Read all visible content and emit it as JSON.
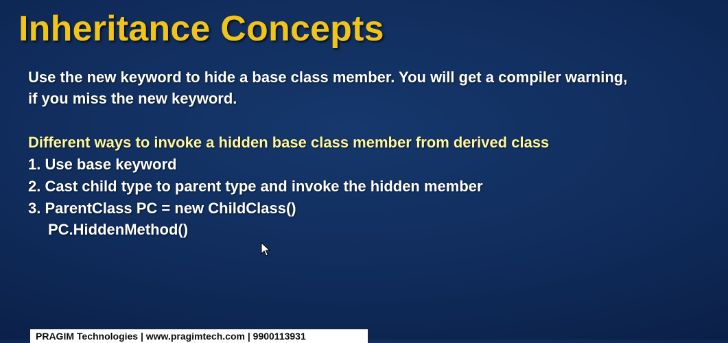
{
  "slide": {
    "title": "Inheritance Concepts",
    "paragraph": [
      "Use the new keyword to hide a base class member. You will get a compiler warning,",
      "if you miss the new keyword."
    ],
    "subheading": "Different ways to invoke a hidden base class member from derived class",
    "items": [
      "1. Use base keyword",
      "2. Cast child type to parent type and invoke the hidden member",
      "3. ParentClass PC = new ChildClass()",
      "PC.HiddenMethod()"
    ],
    "footer": "PRAGIM Technologies | www.pragimtech.com | 9900113931"
  },
  "colors": {
    "title": "#f0c419",
    "subheading": "#fff79a",
    "body_text": "#ffffff",
    "background": "#102c5c"
  },
  "icons": {
    "cursor": "mouse-pointer-icon"
  }
}
